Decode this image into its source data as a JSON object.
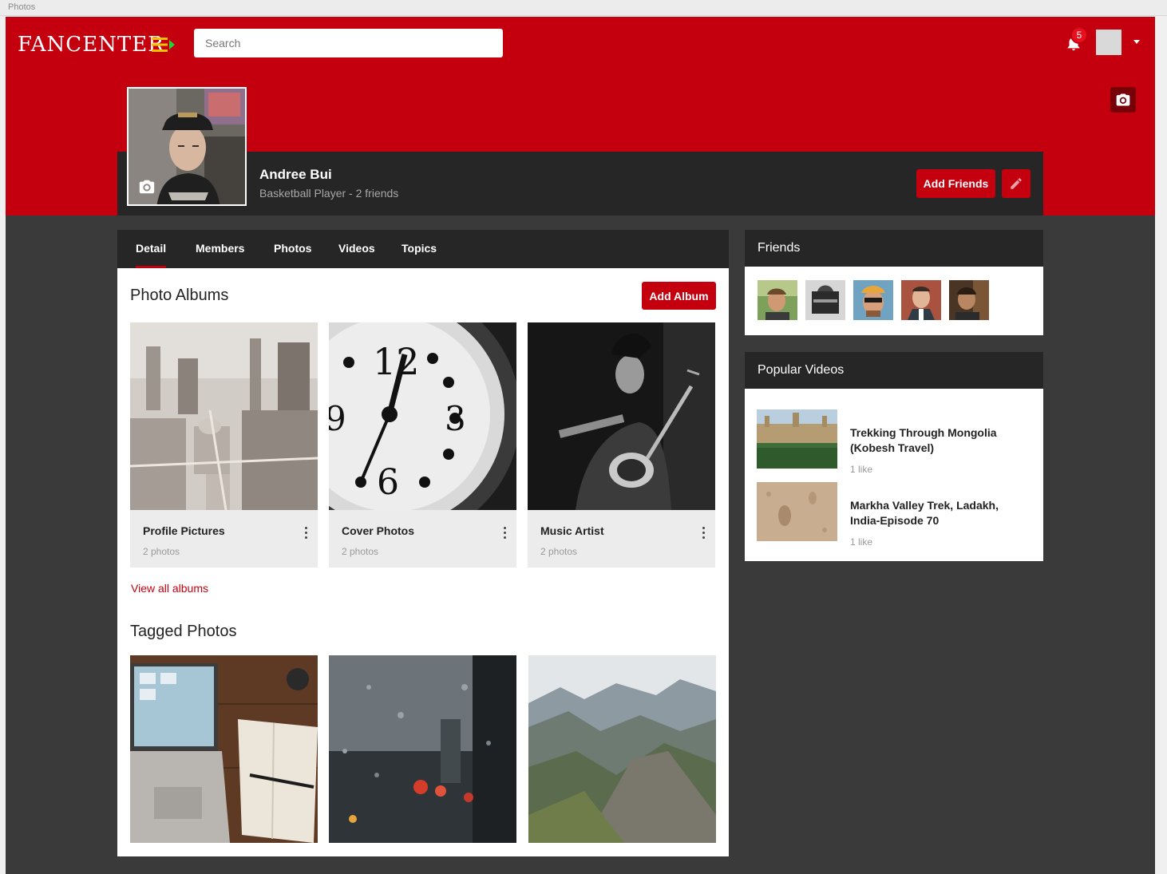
{
  "window": {
    "title": "Photos"
  },
  "header": {
    "logo": "FANCENTER",
    "search_placeholder": "Search",
    "notification_count": "5"
  },
  "profile": {
    "name": "Andree Bui",
    "subtitle": "Basketball Player - 2 friends",
    "add_friends_label": "Add Friends"
  },
  "tabs": [
    {
      "label": "Detail",
      "active": true
    },
    {
      "label": "Members"
    },
    {
      "label": "Photos"
    },
    {
      "label": "Videos"
    },
    {
      "label": "Topics"
    }
  ],
  "albums_section": {
    "title": "Photo Albums",
    "add_album_label": "Add Album",
    "view_all_label": "View all albums",
    "albums": [
      {
        "name": "Profile Pictures",
        "count": "2 photos"
      },
      {
        "name": "Cover Photos",
        "count": "2 photos"
      },
      {
        "name": "Music Artist",
        "count": "2 photos"
      }
    ]
  },
  "tagged_section": {
    "title": "Tagged Photos"
  },
  "friends_panel": {
    "title": "Friends"
  },
  "videos_panel": {
    "title": "Popular Videos",
    "videos": [
      {
        "title": "Trekking Through Mongolia (Kobesh Travel)",
        "likes": "1 like"
      },
      {
        "title": "Markha Valley Trek, Ladakh, India-Episode 70",
        "likes": "1 like"
      }
    ]
  },
  "colors": {
    "brand_red": "#c4000f",
    "dark": "#262626",
    "background": "#3a3a3a"
  },
  "icons": [
    "menu-icon",
    "bell-icon",
    "camera-icon",
    "pencil-icon",
    "more-vertical-icon",
    "caret-down-icon"
  ]
}
